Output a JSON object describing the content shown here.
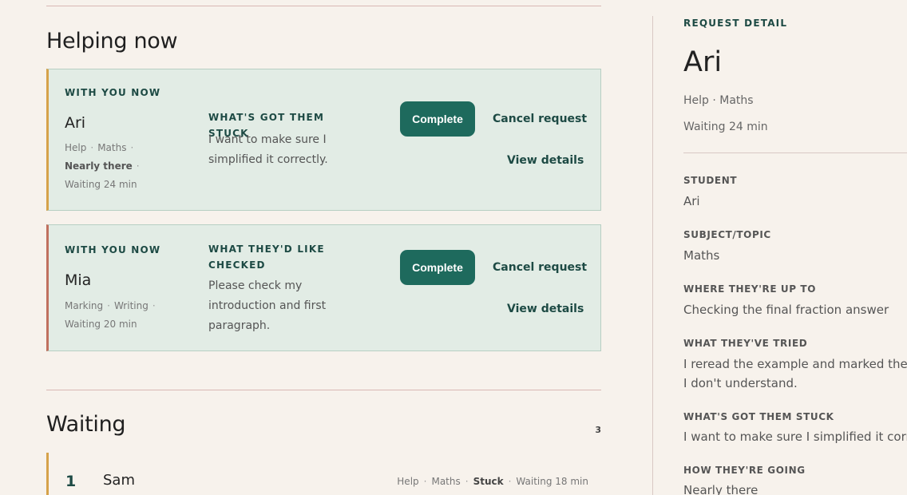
{
  "helping": {
    "title": "Helping now",
    "cards": [
      {
        "eyebrow": "WITH YOU NOW",
        "name": "Ari",
        "type": "Help",
        "subject": "Maths",
        "status": "Nearly there",
        "waiting": "Waiting 24 min",
        "stuck_title": "WHAT'S GOT THEM STUCK",
        "stuck_text": "I want to make sure I simplified it correctly.",
        "complete_label": "Complete",
        "cancel_label": "Cancel request",
        "details_label": "View details"
      },
      {
        "eyebrow": "WITH YOU NOW",
        "name": "Mia",
        "type": "Marking",
        "subject": "Writing",
        "waiting": "Waiting 20 min",
        "stuck_title": "WHAT THEY'D LIKE CHECKED",
        "stuck_text": "Please check my introduction and first paragraph.",
        "complete_label": "Complete",
        "cancel_label": "Cancel request",
        "details_label": "View details"
      }
    ]
  },
  "waiting": {
    "title": "Waiting",
    "count": "3",
    "rows": [
      {
        "position": "1",
        "name": "Sam",
        "type": "Help",
        "subject": "Maths",
        "status": "Stuck",
        "waiting": "Waiting 18 min"
      }
    ]
  },
  "detail": {
    "eyebrow": "REQUEST DETAIL",
    "name": "Ari",
    "summary": "Help · Maths",
    "waiting": "Waiting 24 min",
    "fields": [
      {
        "label": "STUDENT",
        "value": "Ari"
      },
      {
        "label": "SUBJECT/TOPIC",
        "value": "Maths"
      },
      {
        "label": "WHERE THEY'RE UP TO",
        "value": "Checking the final fraction answer"
      },
      {
        "label": "WHAT THEY'VE TRIED",
        "value": "I reread the example and marked the part I don't understand."
      },
      {
        "label": "WHAT'S GOT THEM STUCK",
        "value": "I want to make sure I simplified it correctly."
      },
      {
        "label": "HOW THEY'RE GOING",
        "value": "Nearly there"
      }
    ]
  },
  "colors": {
    "accent": "#1e6a5d",
    "background": "#f7f2ec",
    "card_bg": "#e2ece5",
    "ari_stripe": "#d6a24a",
    "mia_stripe": "#c0705f"
  }
}
